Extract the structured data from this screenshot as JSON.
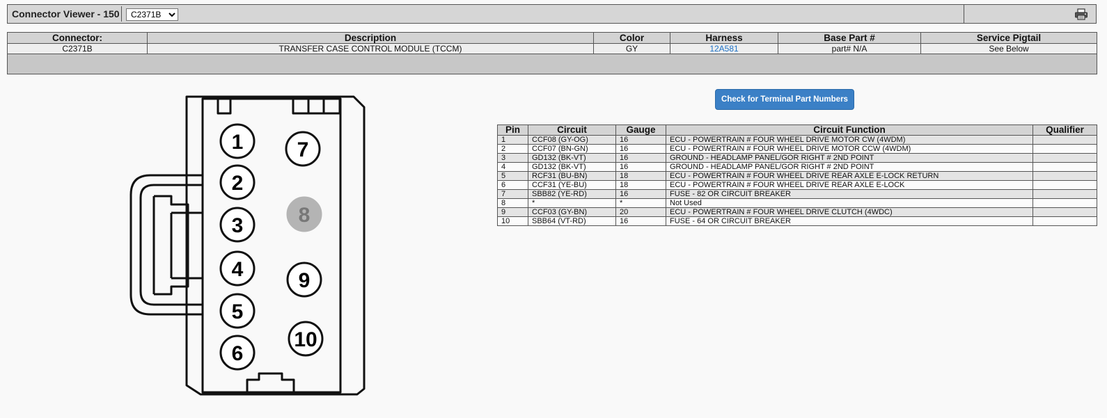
{
  "header": {
    "title": "Connector Viewer - 150",
    "connector_select": {
      "selected": "C2371B",
      "options": [
        "C2371B"
      ]
    },
    "print_icon": "printer-icon"
  },
  "summary": {
    "columns": [
      "Connector:",
      "Description",
      "Color",
      "Harness",
      "Base Part #",
      "Service Pigtail"
    ],
    "row": {
      "connector": "C2371B",
      "description": "TRANSFER CASE CONTROL MODULE (TCCM)",
      "color": "GY",
      "harness": "12A581",
      "base_part": "part# N/A",
      "service_pigtail": "See Below"
    }
  },
  "terminal_button": "Check for Terminal Part Numbers",
  "pins_table": {
    "columns": [
      "Pin",
      "Circuit",
      "Gauge",
      "Circuit Function",
      "Qualifier"
    ],
    "rows": [
      {
        "pin": "1",
        "circuit": "CCF08 (GY-OG)",
        "gauge": "16",
        "function": "ECU - POWERTRAIN # FOUR WHEEL DRIVE MOTOR CW (4WDM)",
        "qualifier": ""
      },
      {
        "pin": "2",
        "circuit": "CCF07 (BN-GN)",
        "gauge": "16",
        "function": "ECU - POWERTRAIN # FOUR WHEEL DRIVE MOTOR CCW (4WDM)",
        "qualifier": ""
      },
      {
        "pin": "3",
        "circuit": "GD132 (BK-VT)",
        "gauge": "16",
        "function": "GROUND - HEADLAMP PANEL/GOR RIGHT # 2ND POINT",
        "qualifier": ""
      },
      {
        "pin": "4",
        "circuit": "GD132 (BK-VT)",
        "gauge": "16",
        "function": "GROUND - HEADLAMP PANEL/GOR RIGHT # 2ND POINT",
        "qualifier": ""
      },
      {
        "pin": "5",
        "circuit": "RCF31 (BU-BN)",
        "gauge": "18",
        "function": "ECU - POWERTRAIN # FOUR WHEEL DRIVE REAR AXLE E-LOCK RETURN",
        "qualifier": ""
      },
      {
        "pin": "6",
        "circuit": "CCF31 (YE-BU)",
        "gauge": "18",
        "function": "ECU - POWERTRAIN # FOUR WHEEL DRIVE REAR AXLE E-LOCK",
        "qualifier": ""
      },
      {
        "pin": "7",
        "circuit": "SBB82 (YE-RD)",
        "gauge": "16",
        "function": "FUSE - 82 OR CIRCUIT BREAKER",
        "qualifier": ""
      },
      {
        "pin": "8",
        "circuit": "*",
        "gauge": "*",
        "function": "Not Used",
        "qualifier": ""
      },
      {
        "pin": "9",
        "circuit": "CCF03 (GY-BN)",
        "gauge": "20",
        "function": "ECU - POWERTRAIN # FOUR WHEEL DRIVE CLUTCH (4WDC)",
        "qualifier": ""
      },
      {
        "pin": "10",
        "circuit": "SBB64 (VT-RD)",
        "gauge": "16",
        "function": "FUSE - 64 OR CIRCUIT BREAKER",
        "qualifier": ""
      }
    ]
  },
  "connector_diagram": {
    "pins": [
      {
        "label": "1",
        "used": true
      },
      {
        "label": "2",
        "used": true
      },
      {
        "label": "3",
        "used": true
      },
      {
        "label": "4",
        "used": true
      },
      {
        "label": "5",
        "used": true
      },
      {
        "label": "6",
        "used": true
      },
      {
        "label": "7",
        "used": true
      },
      {
        "label": "8",
        "used": false
      },
      {
        "label": "9",
        "used": true
      },
      {
        "label": "10",
        "used": true
      }
    ],
    "colors": {
      "pin_used_fill": "#ffffff",
      "pin_unused_fill": "#b4b4b4",
      "pin_unused_text": "#777777",
      "button": "#3b80c6",
      "link": "#1e73c8"
    }
  }
}
